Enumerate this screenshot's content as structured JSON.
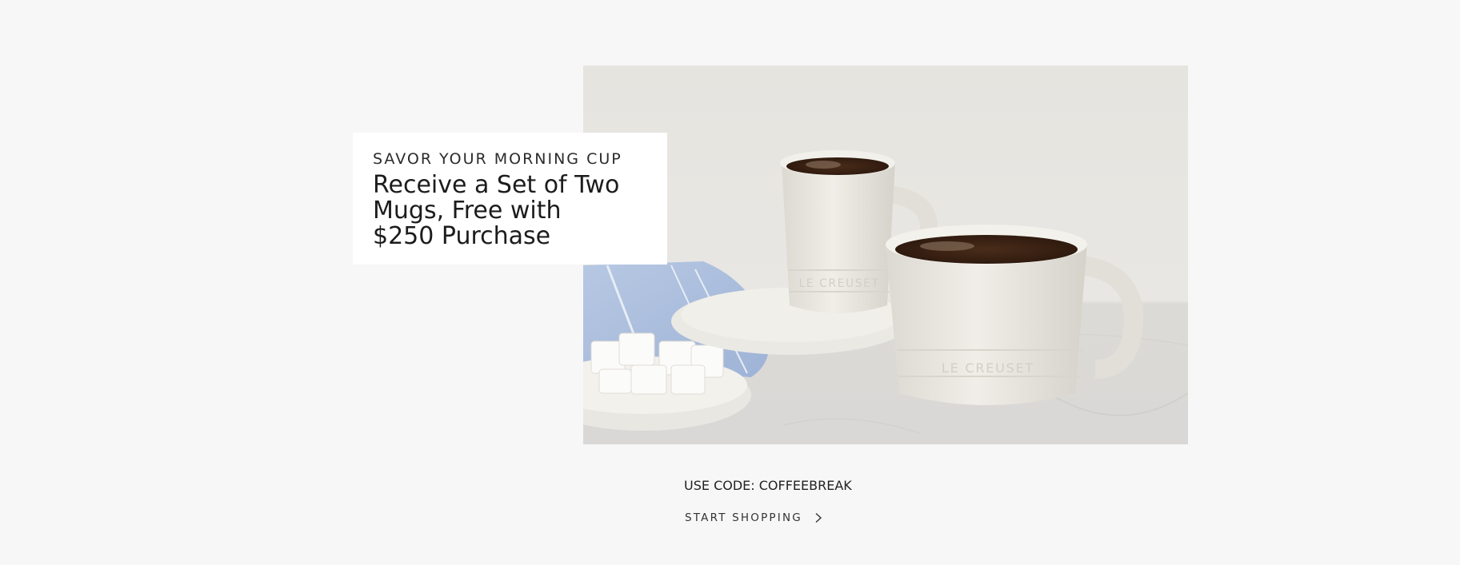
{
  "promo": {
    "eyebrow": "SAVOR YOUR MORNING CUP",
    "headline": "Receive a Set of Two Mugs, Free with $250 Purchase",
    "code_text": "USE CODE: COFFEEBREAK",
    "cta_label": "START SHOPPING",
    "cta_icon": "chevron-right-icon",
    "mug_brand_mark": "LE CREUSET"
  },
  "colors": {
    "page_background": "#f7f7f7",
    "card_background": "#ffffff",
    "text": "#222222"
  }
}
